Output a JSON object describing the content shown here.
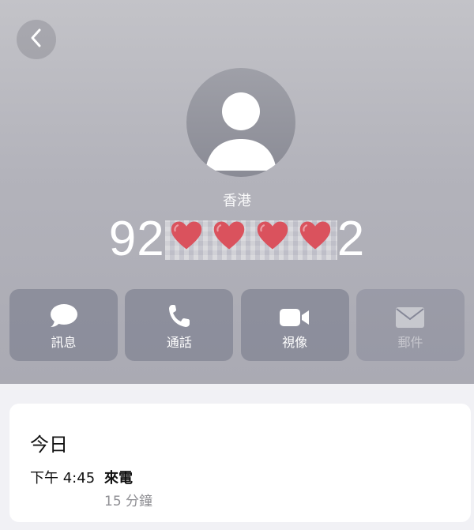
{
  "contact": {
    "region": "香港",
    "number_prefix": "92",
    "number_suffix": "2"
  },
  "header": {
    "back_icon": "chevron-left-icon"
  },
  "actions": [
    {
      "label": "訊息",
      "icon": "message-icon",
      "enabled": true
    },
    {
      "label": "通話",
      "icon": "phone-icon",
      "enabled": true
    },
    {
      "label": "視像",
      "icon": "video-icon",
      "enabled": true
    },
    {
      "label": "郵件",
      "icon": "mail-icon",
      "enabled": false
    }
  ],
  "call_log": {
    "date_label": "今日",
    "entries": [
      {
        "time": "下午 4:45",
        "type": "來電",
        "duration": "15 分鐘"
      }
    ]
  },
  "colors": {
    "header_bg": "#b3b3bb",
    "heart": "#e8333f",
    "card_bg": "#ffffff"
  }
}
